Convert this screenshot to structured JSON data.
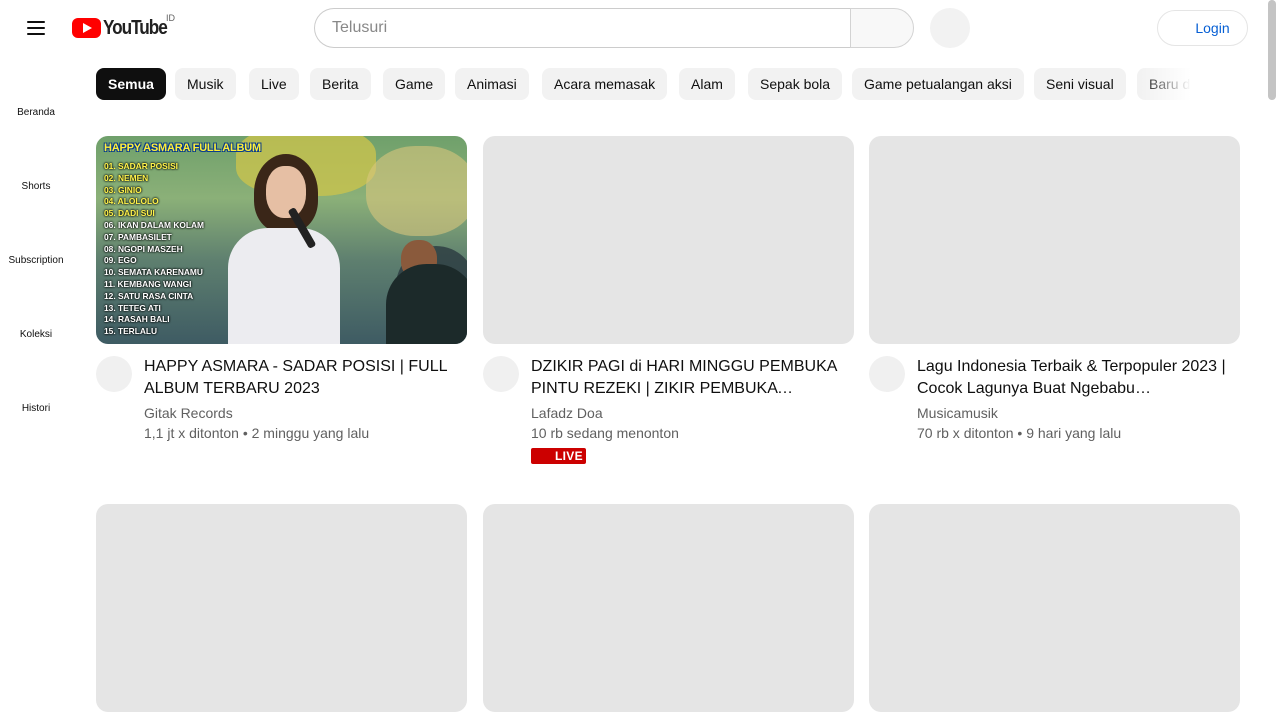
{
  "header": {
    "logo_text": "YouTube",
    "country_code": "ID",
    "search_placeholder": "Telusuri",
    "login_label": "Login"
  },
  "sidebar": {
    "items": [
      {
        "label": "Beranda"
      },
      {
        "label": "Shorts"
      },
      {
        "label": "Subscription"
      },
      {
        "label": "Koleksi"
      },
      {
        "label": "Histori"
      }
    ]
  },
  "chips": [
    {
      "label": "Semua",
      "active": true
    },
    {
      "label": "Musik"
    },
    {
      "label": "Live"
    },
    {
      "label": "Berita"
    },
    {
      "label": "Game"
    },
    {
      "label": "Animasi"
    },
    {
      "label": "Acara memasak"
    },
    {
      "label": "Alam"
    },
    {
      "label": "Sepak bola"
    },
    {
      "label": "Game petualangan aksi"
    },
    {
      "label": "Seni visual"
    },
    {
      "label": "Baru diu"
    }
  ],
  "videos": [
    {
      "title": "HAPPY ASMARA - SADAR POSISI | FULL ALBUM TERBARU 2023",
      "channel": "Gitak Records",
      "meta": "1,1 jt x ditonton • 2 minggu yang lalu",
      "thumbnail": {
        "heading": "HAPPY ASMARA FULL ALBUM",
        "tracks": [
          "01. SADAR POSISI",
          "02. NEMEN",
          "03. GINIO",
          "04. ALOLOLO",
          "05. DADI SUI",
          "06. IKAN DALAM KOLAM",
          "07. PAMBASILET",
          "08. NGOPI MASZEH",
          "09. EGO",
          "10. SEMATA KARENAMU",
          "11. KEMBANG WANGI",
          "12. SATU RASA CINTA",
          "13. TETEG ATI",
          "14. RASAH BALI",
          "15. TERLALU"
        ]
      }
    },
    {
      "title": "DZIKIR PAGI di HARI MINGGU PEMBUKA PINTU REZEKI | ZIKIR PEMBUKA PINTU…",
      "channel": "Lafadz Doa",
      "meta": "10 rb sedang menonton",
      "badge": "LIVE"
    },
    {
      "title": "Lagu Indonesia Terbaik & Terpopuler 2023 | Cocok Lagunya Buat Ngebabu…",
      "channel": "Musicamusik",
      "meta": "70 rb x ditonton • 9 hari yang lalu"
    }
  ],
  "colors": {
    "brand_red": "#ff0000",
    "live_red": "#cc0000",
    "link_blue": "#065fd4",
    "placeholder_gray": "#e5e5e5"
  }
}
